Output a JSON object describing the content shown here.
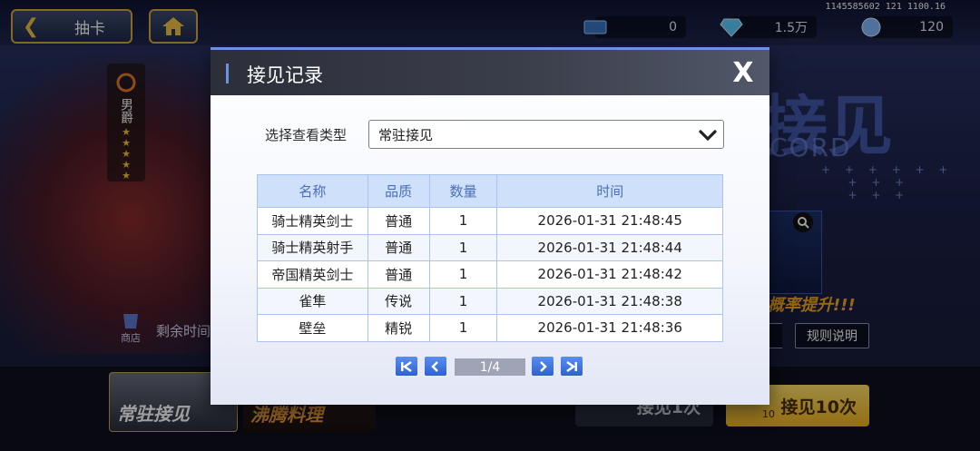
{
  "top_bar": {
    "back_label": "抽卡",
    "currencies": [
      {
        "icon": "ticket-icon",
        "value": "0"
      },
      {
        "icon": "diamond-icon",
        "value": "1.5万"
      },
      {
        "icon": "crystal-icon",
        "value": "120"
      }
    ],
    "device_info": "1145585602 121 1100.16"
  },
  "background": {
    "rank_title": "男爵",
    "shop_label": "商店",
    "remaining_label": "剩余时间",
    "promo_text": "概率提升!!!",
    "rules_label": "规则说明",
    "big_title": "接见",
    "big_subtitle": "CORD",
    "banners": [
      "常驻接见",
      "沸腾料理"
    ],
    "summon_one": "接见1次",
    "summon_ten": "接见10次",
    "summon_ten_cost": "10"
  },
  "modal": {
    "title": "接见记录",
    "close_label": "X",
    "filter_label": "选择查看类型",
    "filter_value": "常驻接见",
    "columns": [
      "名称",
      "品质",
      "数量",
      "时间"
    ],
    "rows": [
      {
        "name": "骑士精英剑士",
        "quality": "普通",
        "quality_class": "q-normal",
        "count": "1",
        "time": "2026-01-31 21:48:45"
      },
      {
        "name": "骑士精英射手",
        "quality": "普通",
        "quality_class": "q-normal",
        "count": "1",
        "time": "2026-01-31 21:48:44"
      },
      {
        "name": "帝国精英剑士",
        "quality": "普通",
        "quality_class": "q-normal",
        "count": "1",
        "time": "2026-01-31 21:48:42"
      },
      {
        "name": "雀隼",
        "quality": "传说",
        "quality_class": "q-legend",
        "count": "1",
        "time": "2026-01-31 21:48:38"
      },
      {
        "name": "壁垒",
        "quality": "精锐",
        "quality_class": "q-elite",
        "count": "1",
        "time": "2026-01-31 21:48:36"
      }
    ],
    "pagination": "1/4"
  },
  "colors": {
    "accent": "#6d8fe6",
    "table_header_bg": "#cfe0fb",
    "quality_normal": "#4a6fb4",
    "quality_legend": "#f2a533",
    "quality_elite": "#c86bd6"
  }
}
